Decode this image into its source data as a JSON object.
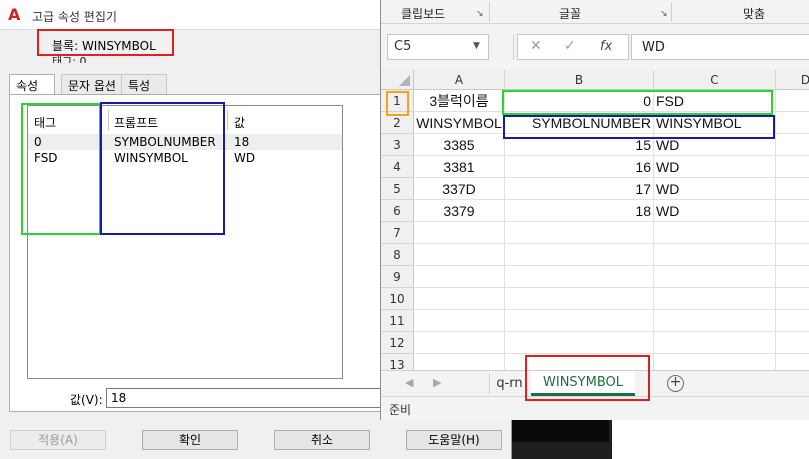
{
  "dialog": {
    "title": "고급 속성 편집기",
    "block_line": "블록: WINSYMBOL",
    "tag_line": "태그: 0",
    "tabs": [
      {
        "label": "속성"
      },
      {
        "label": "문자 옵션"
      },
      {
        "label": "특성"
      }
    ],
    "grid": {
      "headers": {
        "tag": "태그",
        "prompt": "프롬프트",
        "value": "값"
      },
      "rows": [
        {
          "tag": "0",
          "prompt": "SYMBOLNUMBER",
          "value": "18"
        },
        {
          "tag": "FSD",
          "prompt": "WINSYMBOL",
          "value": "WD"
        }
      ]
    },
    "value_label": "값(V):",
    "value_input": "18",
    "buttons": {
      "apply": "적용(A)",
      "ok": "확인",
      "cancel": "취소",
      "help": "도움말(H)"
    }
  },
  "excel": {
    "ribbon_groups": [
      "클립보드",
      "글꼴",
      "맞춤"
    ],
    "name_box": "C5",
    "formula_value": "WD",
    "columns": [
      "A",
      "B",
      "C",
      "D"
    ],
    "rows": [
      {
        "n": "1",
        "a": "3블럭이름",
        "b": "0",
        "c": "FSD"
      },
      {
        "n": "2",
        "a": "WINSYMBOL",
        "b": "SYMBOLNUMBER",
        "c": "WINSYMBOL"
      },
      {
        "n": "3",
        "a": "3385",
        "b": "15",
        "c": "WD"
      },
      {
        "n": "4",
        "a": "3381",
        "b": "16",
        "c": "WD"
      },
      {
        "n": "5",
        "a": "337D",
        "b": "17",
        "c": "WD"
      },
      {
        "n": "6",
        "a": "3379",
        "b": "18",
        "c": "WD"
      },
      {
        "n": "7",
        "a": "",
        "b": "",
        "c": ""
      },
      {
        "n": "8",
        "a": "",
        "b": "",
        "c": ""
      },
      {
        "n": "9",
        "a": "",
        "b": "",
        "c": ""
      },
      {
        "n": "10",
        "a": "",
        "b": "",
        "c": ""
      },
      {
        "n": "11",
        "a": "",
        "b": "",
        "c": ""
      },
      {
        "n": "12",
        "a": "",
        "b": "",
        "c": ""
      },
      {
        "n": "13",
        "a": "",
        "b": "",
        "c": ""
      }
    ],
    "sheet_tabs": [
      {
        "label": "q-rn",
        "active": false
      },
      {
        "label": "WINSYMBOL",
        "active": true
      }
    ],
    "add_sheet": "+",
    "status": "준비"
  },
  "colors": {
    "annotation_red": "#e02020",
    "annotation_green": "#2bd62b",
    "annotation_blue": "#1a1aa8",
    "annotation_orange": "#f5a31a",
    "excel_green": "#1d6f42"
  }
}
